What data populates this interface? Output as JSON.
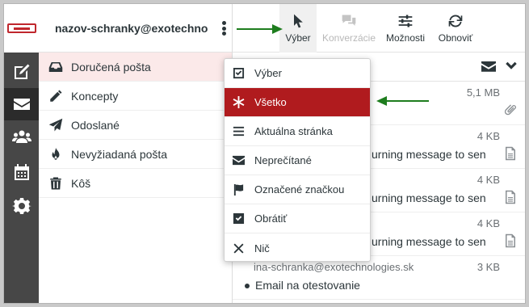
{
  "account": {
    "name": "nazov-schranky@exotechnol..."
  },
  "rail": [
    {
      "name": "compose-icon"
    },
    {
      "name": "mail-icon"
    },
    {
      "name": "contacts-icon"
    },
    {
      "name": "calendar-icon"
    },
    {
      "name": "settings-icon"
    }
  ],
  "folders": [
    {
      "label": "Doručená pošta",
      "icon": "inbox-icon"
    },
    {
      "label": "Koncepty",
      "icon": "pencil-icon"
    },
    {
      "label": "Odoslané",
      "icon": "send-icon"
    },
    {
      "label": "Nevyžiadaná pošta",
      "icon": "fire-icon"
    },
    {
      "label": "Kôš",
      "icon": "trash-icon"
    }
  ],
  "toolbar": {
    "select_label": "Výber",
    "threads_label": "Konverzácie",
    "options_label": "Možnosti",
    "refresh_label": "Obnoviť"
  },
  "dropdown": {
    "items": [
      {
        "label": "Výber",
        "icon": "checkbox-icon"
      },
      {
        "label": "Všetko",
        "icon": "asterisk-icon"
      },
      {
        "label": "Aktuálna stránka",
        "icon": "list-icon"
      },
      {
        "label": "Neprečítané",
        "icon": "envelope-icon"
      },
      {
        "label": "Označené značkou",
        "icon": "flag-icon"
      },
      {
        "label": "Obrátiť",
        "icon": "checkbox-checked-icon"
      },
      {
        "label": "Nič",
        "icon": "x-icon"
      }
    ]
  },
  "messages": [
    {
      "from": "",
      "size": "5,1 MB",
      "subject": ""
    },
    {
      "from": "",
      "size": "4 KB",
      "subject": "urning message to sen"
    },
    {
      "from": "",
      "size": "4 KB",
      "subject": "urning message to sen"
    },
    {
      "from": "",
      "size": "4 KB",
      "subject": "urning message to sen"
    },
    {
      "from": "ina-schranka@exotechnologies.sk",
      "size": "3 KB",
      "subject": "Email na otestovanie"
    }
  ],
  "colors": {
    "accent": "#b01b1e",
    "arrow": "#1e7d1e",
    "rail": "#474747"
  }
}
